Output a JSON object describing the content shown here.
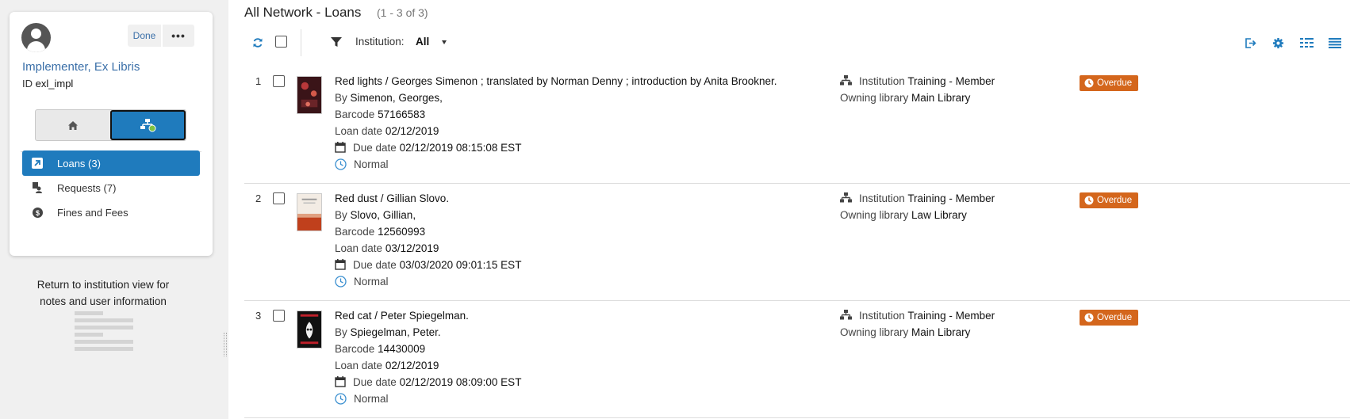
{
  "user_card": {
    "done_label": "Done",
    "more_label": "•••",
    "name": "Implementer, Ex Libris",
    "id_label": "ID",
    "id_value": "exl_impl"
  },
  "nav": {
    "items": [
      {
        "label": "Loans (3)",
        "icon": "loans-icon",
        "active": true
      },
      {
        "label": "Requests (7)",
        "icon": "requests-icon",
        "active": false
      },
      {
        "label": "Fines and Fees",
        "icon": "dollar-icon",
        "active": false
      }
    ]
  },
  "return_text": "Return to institution view for notes and user information",
  "header": {
    "title": "All Network - Loans",
    "count": "(1 - 3 of 3)"
  },
  "toolbar": {
    "institution_label": "Institution:",
    "institution_value": "All"
  },
  "colors": {
    "accent": "#1f7bbd",
    "link": "#3a6fa8",
    "overdue": "#d4661c",
    "clock": "#3a8fd0"
  },
  "labels": {
    "by": "By",
    "barcode": "Barcode",
    "loan_date": "Loan date",
    "due_date": "Due date",
    "institution": "Institution",
    "owning_library": "Owning library"
  },
  "loans": [
    {
      "num": "1",
      "title": "Red lights / Georges Simenon ; translated by Norman Denny ; introduction by Anita Brookner.",
      "author": "Simenon, Georges,",
      "barcode": "57166583",
      "loan_date": "02/12/2019",
      "due_date": "02/12/2019 08:15:08 EST",
      "policy": "Normal",
      "institution": "Training - Member",
      "library": "Main Library",
      "status": "Overdue"
    },
    {
      "num": "2",
      "title": "Red dust / Gillian Slovo.",
      "author": "Slovo, Gillian,",
      "barcode": "12560993",
      "loan_date": "03/12/2019",
      "due_date": "03/03/2020 09:01:15 EST",
      "policy": "Normal",
      "institution": "Training - Member",
      "library": "Law Library",
      "status": "Overdue"
    },
    {
      "num": "3",
      "title": "Red cat / Peter Spiegelman.",
      "author": "Spiegelman, Peter.",
      "barcode": "14430009",
      "loan_date": "02/12/2019",
      "due_date": "02/12/2019 08:09:00 EST",
      "policy": "Normal",
      "institution": "Training - Member",
      "library": "Main Library",
      "status": "Overdue"
    }
  ]
}
